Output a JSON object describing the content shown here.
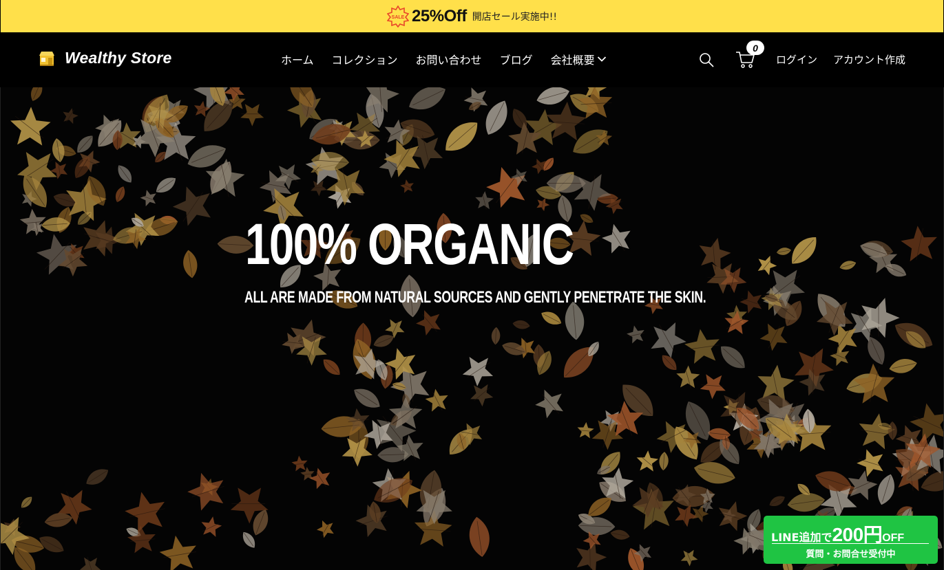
{
  "announcement": {
    "badge_text": "SALE",
    "headline": "25%Off",
    "text": "開店セール実施中!!"
  },
  "header": {
    "logo_text": "Wealthy Store",
    "nav": [
      {
        "label": "ホーム"
      },
      {
        "label": "コレクション"
      },
      {
        "label": "お問い合わせ"
      },
      {
        "label": "ブログ"
      },
      {
        "label": "会社概要",
        "has_dropdown": true
      }
    ],
    "icons": {
      "search": "search-icon",
      "cart": "cart-icon"
    },
    "cart_count": "0",
    "login": "ログイン",
    "signup": "アカウント作成"
  },
  "hero": {
    "title": "100% ORGANIC",
    "subtitle": "ALL ARE MADE FROM NATURAL SOURCES AND GENTLY PENETRATE THE SKIN."
  },
  "line_banner": {
    "prefix": "LINE追加で",
    "amount": "200円",
    "suffix": "OFF",
    "subtext": "質問・お問合せ受付中"
  },
  "colors": {
    "announcement_bg": "#ffe04a",
    "header_bg": "#000000",
    "line_green": "#1fc443",
    "sale_red": "#e8442a"
  }
}
